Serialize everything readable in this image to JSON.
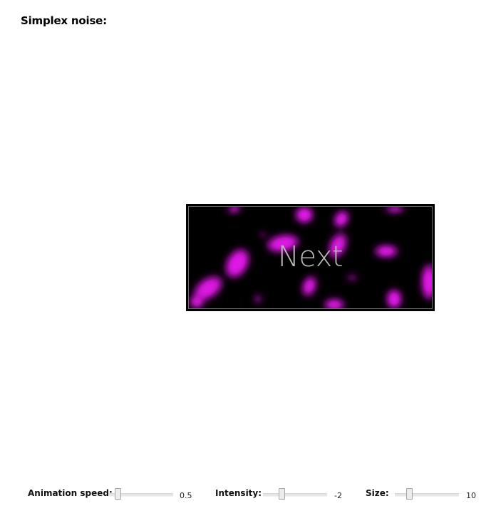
{
  "page": {
    "title": "Simplex noise:"
  },
  "noise_button": {
    "label": "Next",
    "colors": {
      "background": "#000000",
      "blob": "#e018e6",
      "label": "#b9b9b9"
    }
  },
  "controls": {
    "animation_speed": {
      "label": "Animation speed:",
      "value": "0.5",
      "fraction": 0.1
    },
    "intensity": {
      "label": "Intensity:",
      "value": "-2",
      "fraction": 0.27
    },
    "size": {
      "label": "Size:",
      "value": "10",
      "fraction": 0.2
    }
  }
}
